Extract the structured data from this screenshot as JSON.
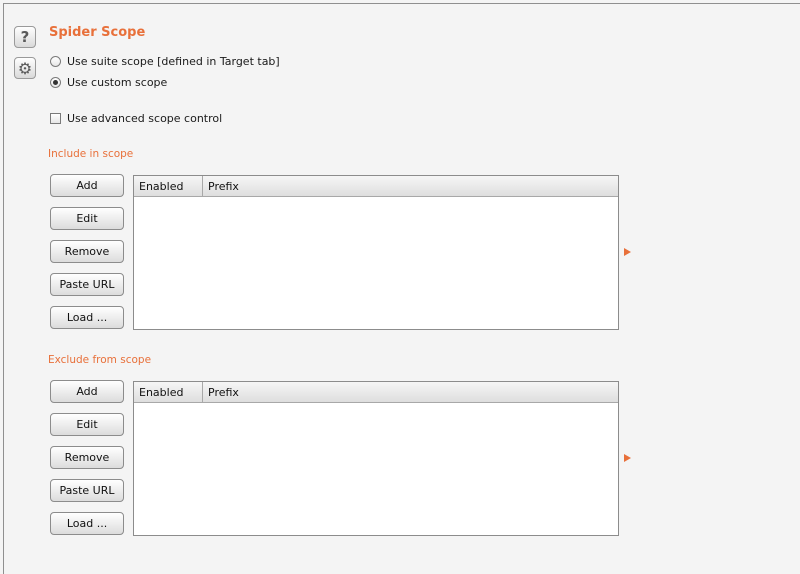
{
  "panel": {
    "title": "Spider Scope"
  },
  "scope_options": {
    "suite_scope_label": "Use suite scope [defined in Target tab]",
    "custom_scope_label": "Use custom scope",
    "selected": "custom",
    "advanced_label": "Use advanced scope control",
    "advanced_checked": false
  },
  "include": {
    "label": "Include in scope",
    "buttons": [
      "Add",
      "Edit",
      "Remove",
      "Paste URL",
      "Load ..."
    ],
    "columns": [
      "Enabled",
      "Prefix"
    ],
    "rows": []
  },
  "exclude": {
    "label": "Exclude from scope",
    "buttons": [
      "Add",
      "Edit",
      "Remove",
      "Paste URL",
      "Load ..."
    ],
    "columns": [
      "Enabled",
      "Prefix"
    ],
    "rows": []
  },
  "icons": {
    "help": "help-icon",
    "settings": "gear-icon",
    "expand": "expand-arrow-icon"
  },
  "colors": {
    "accent": "#e8703a"
  }
}
